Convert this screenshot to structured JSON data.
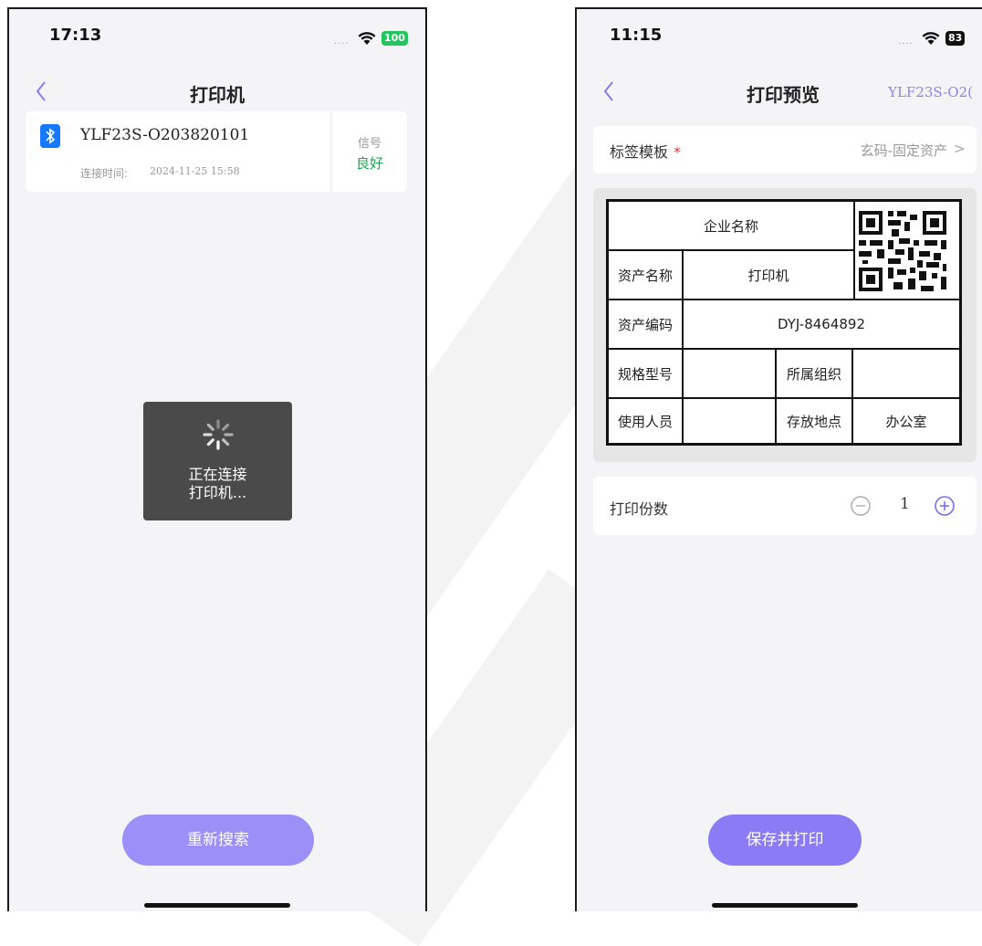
{
  "phone1": {
    "status": {
      "time": "17:13",
      "dots": "....",
      "battery": "100"
    },
    "nav": {
      "title": "打印机"
    },
    "device": {
      "name": "YLF23S-O203820101",
      "conn_label": "连接时间:",
      "conn_time": "2024-11-25 15:58",
      "signal_label": "信号",
      "signal_value": "良好"
    },
    "toast": {
      "line1": "正在连接",
      "line2": "打印机..."
    },
    "button": "重新搜索"
  },
  "phone2": {
    "status": {
      "time": "11:15",
      "dots": "....",
      "battery": "83"
    },
    "nav": {
      "title": "打印预览",
      "right": "YLF23S-O2("
    },
    "template": {
      "label": "标签模板",
      "required": "*",
      "value": "玄码-固定资产",
      "chevron": ">"
    },
    "label": {
      "company": "企业名称",
      "asset_name_label": "资产名称",
      "asset_name_value": "打印机",
      "asset_code_label": "资产编码",
      "asset_code_value": "DYJ-8464892",
      "spec_label": "规格型号",
      "spec_value": "",
      "org_label": "所属组织",
      "org_value": "",
      "user_label": "使用人员",
      "user_value": "",
      "location_label": "存放地点",
      "location_value": "办公室"
    },
    "copies": {
      "label": "打印份数",
      "value": "1"
    },
    "button": "保存并打印"
  },
  "colors": {
    "accent": "#8b7cf6",
    "signal_good": "#19a64a",
    "bluetooth": "#1677ff",
    "required": "#e53935",
    "battery": "#22c55e"
  }
}
